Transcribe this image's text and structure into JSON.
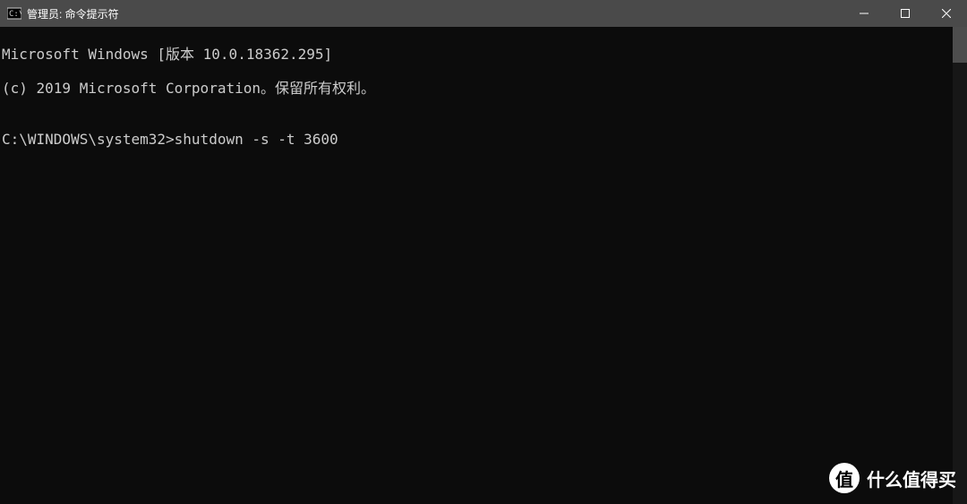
{
  "titlebar": {
    "title": "管理员: 命令提示符"
  },
  "terminal": {
    "line1": "Microsoft Windows [版本 10.0.18362.295]",
    "line2": "(c) 2019 Microsoft Corporation。保留所有权利。",
    "line3": "",
    "prompt": "C:\\WINDOWS\\system32>",
    "command": "shutdown -s -t 3600"
  },
  "watermark": {
    "badge": "值",
    "text": "什么值得买"
  }
}
